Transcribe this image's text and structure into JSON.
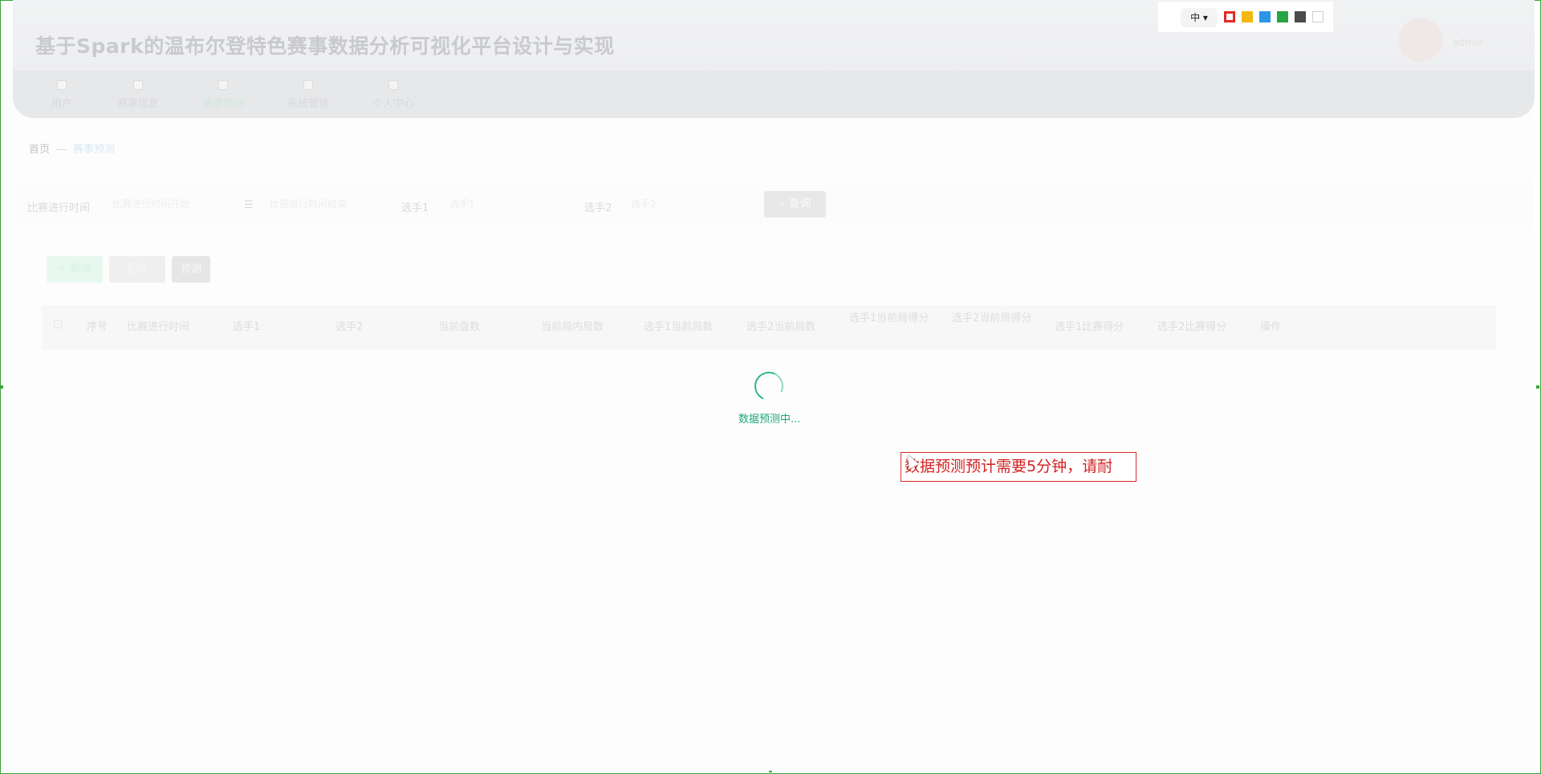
{
  "header": {
    "title": "基于Spark的温布尔登特色赛事数据分析可视化平台设计与实现",
    "nav": [
      {
        "label": "用户"
      },
      {
        "label": "赛事信息"
      },
      {
        "label": "赛事预测"
      },
      {
        "label": "系统管理"
      },
      {
        "label": "个人中心"
      }
    ],
    "user_name": "admin"
  },
  "breadcrumb": {
    "home": "首页",
    "sep": "—",
    "current": "赛事预测"
  },
  "search": {
    "label_time": "比赛进行时间",
    "placeholder_start": "比赛进行时间开始",
    "placeholder_end": "比赛进行时间结束",
    "label_player1": "选手1",
    "placeholder_player1": "选手1",
    "label_player2": "选手2",
    "placeholder_player2": "选手2",
    "query_label": "查询"
  },
  "actions": {
    "add": "+ 新增",
    "delete": "删除",
    "predict": "预测"
  },
  "table": {
    "headers": [
      "序号",
      "比赛进行时间",
      "选手1",
      "选手2",
      "当前盘数",
      "当前局内局数",
      "选手1当前局数",
      "选手2当前局数",
      "选手1当前局得分",
      "选手2当前局得分",
      "选手1比赛得分",
      "选手2比赛得分",
      "操作"
    ]
  },
  "loading": {
    "text": "数据预测中..."
  },
  "toolbar": {
    "lang": "中",
    "colors": [
      "#e12a2a",
      "#f4b70f",
      "#2b94e6",
      "#27a443",
      "#4b4b4d",
      "#ffffff"
    ]
  },
  "annotation": {
    "text": "数据预测预计需要5分钟，请耐"
  }
}
